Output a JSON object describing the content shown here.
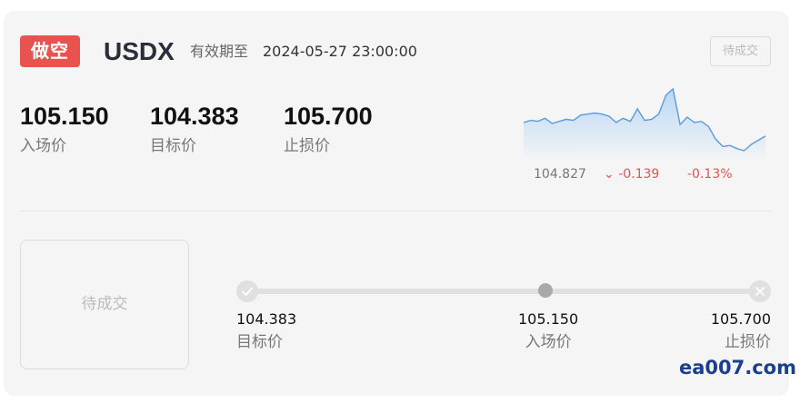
{
  "header": {
    "direction_badge": "做空",
    "symbol": "USDX",
    "expiry_label": "有效期至",
    "expiry_value": "2024-05-27 23:00:00",
    "status_button": "待成交"
  },
  "stats": [
    {
      "value": "105.150",
      "label": "入场价"
    },
    {
      "value": "104.383",
      "label": "目标价"
    },
    {
      "value": "105.700",
      "label": "止损价"
    }
  ],
  "sparkline": {
    "price": "104.827",
    "change": "-0.139",
    "change_pct": "-0.13%",
    "line_color": "#5b9bd9",
    "points": [
      104.95,
      104.97,
      104.96,
      104.99,
      104.94,
      104.96,
      104.98,
      104.97,
      105.02,
      105.03,
      105.04,
      105.03,
      105.01,
      104.95,
      104.99,
      104.96,
      105.08,
      104.97,
      104.98,
      105.03,
      105.21,
      105.27,
      104.93,
      105.0,
      104.95,
      104.96,
      104.91,
      104.79,
      104.72,
      104.73,
      104.7,
      104.68,
      104.74,
      104.78,
      104.82
    ]
  },
  "progress": {
    "status_box": "待成交",
    "points": [
      {
        "value": "104.383",
        "label": "目标价"
      },
      {
        "value": "105.150",
        "label": "入场价"
      },
      {
        "value": "105.700",
        "label": "止损价"
      }
    ]
  },
  "colors": {
    "short_badge": "#e8524f",
    "negative": "#e8524f"
  },
  "watermark": "ea007.com"
}
